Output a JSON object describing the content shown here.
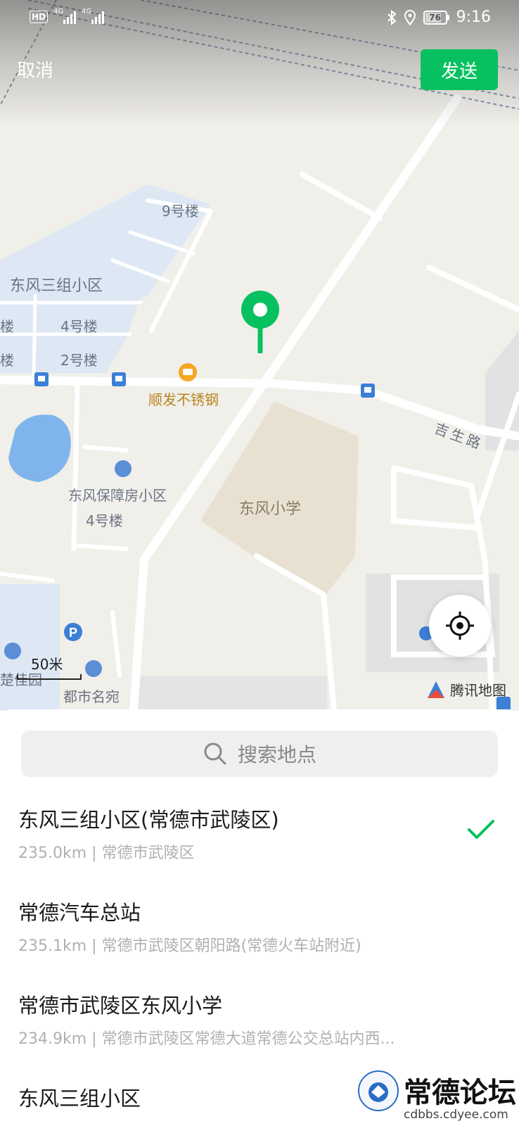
{
  "status_bar": {
    "hd": "HD",
    "network_1": "4G",
    "network_2": "4G",
    "battery": "76",
    "time": "9:16"
  },
  "header": {
    "cancel": "取消",
    "send": "发送"
  },
  "map": {
    "labels": {
      "building_9": "9号楼",
      "dongfeng_san": "东风三组小区",
      "lou_a": "楼",
      "building_4": "4号楼",
      "lou_b": "楼",
      "building_2": "2号楼",
      "shunfa": "顺发不锈钢",
      "jisheng_road": "吉生路",
      "dongfeng_baozhang": "东风保障房小区",
      "building_4b": "4号楼",
      "dongfeng_school": "东风小学",
      "chujia": "楚佳园",
      "dushi": "都市名宛"
    },
    "scale": "50米",
    "provider": "腾讯地图",
    "colors": {
      "pin": "#07c160",
      "poi": "#f5a623",
      "water": "#7fb5ec",
      "residential": "#dde8f4"
    }
  },
  "search": {
    "placeholder": "搜索地点"
  },
  "places": [
    {
      "title": "东风三组小区(常德市武陵区)",
      "distance": "235.0km",
      "address": "常德市武陵区",
      "selected": true
    },
    {
      "title": "常德汽车总站",
      "distance": "235.1km",
      "address": "常德市武陵区朝阳路(常德火车站附近)",
      "selected": false
    },
    {
      "title": "常德市武陵区东风小学",
      "distance": "234.9km",
      "address": "常德市武陵区常德大道常德公交总站内西...",
      "selected": false
    },
    {
      "title": "东风三组小区",
      "distance": "",
      "address": "",
      "selected": false
    }
  ],
  "watermark": {
    "name": "常德论坛",
    "url": "cdbbs.cdyee.com"
  }
}
